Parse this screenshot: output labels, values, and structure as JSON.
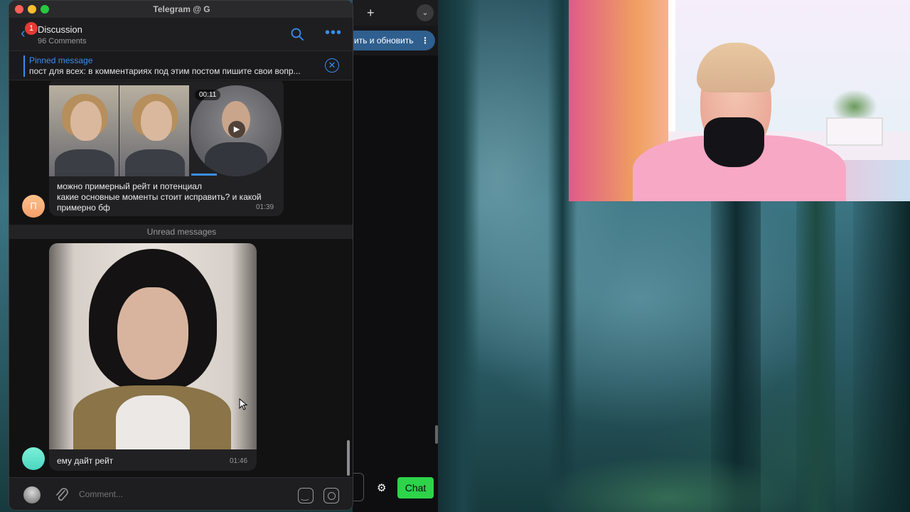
{
  "window": {
    "title": "Telegram @ G"
  },
  "header": {
    "title": "Discussion",
    "subtitle": "96 Comments",
    "badge_count": "1",
    "back_icon": "chevron-left-icon",
    "search_icon": "search-icon",
    "more_icon": "more-horizontal-icon"
  },
  "pinned": {
    "title": "Pinned message",
    "text": "пост для всех:   в комментариях под этим постом пишите свои вопр..."
  },
  "messages": [
    {
      "avatar_letter": "П",
      "video_duration": "00:11",
      "text_lines": [
        "можно примерный рейт и потенциал",
        "какие основные моменты стоит исправить? и какой",
        "примерно бф"
      ],
      "time": "01:39"
    },
    {
      "text": "ему дайт рейт",
      "time": "01:46"
    }
  ],
  "divider": {
    "unread_label": "Unread messages"
  },
  "composer": {
    "placeholder": "Comment..."
  },
  "background_app": {
    "button_label": "ить и обновить",
    "chat_label": "Chat",
    "tab_add": "+",
    "tab_menu": "⌄"
  },
  "colors": {
    "accent": "#3a8df2",
    "chat_button": "#2ed34a",
    "badge": "#e53935"
  }
}
